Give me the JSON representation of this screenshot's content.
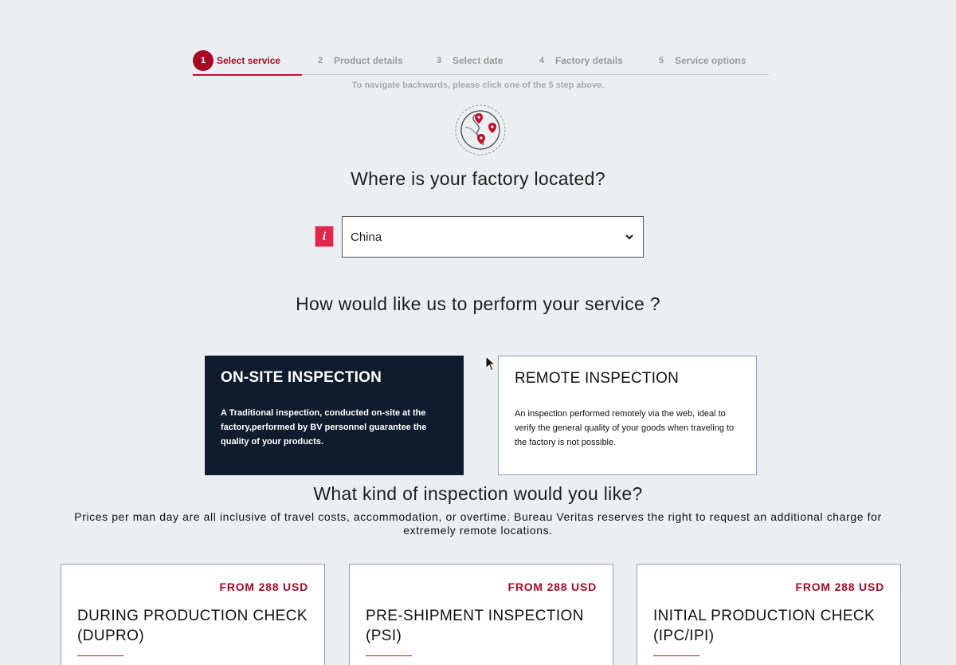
{
  "stepper": {
    "steps": [
      {
        "num": "1",
        "label": "Select service"
      },
      {
        "num": "2",
        "label": "Product details"
      },
      {
        "num": "3",
        "label": "Select date"
      },
      {
        "num": "4",
        "label": "Factory details"
      },
      {
        "num": "5",
        "label": "Service options"
      }
    ],
    "active_step": 1,
    "hint": "To navigate backwards, please click one of the 5 step above."
  },
  "location": {
    "icon": "map-route-icon",
    "question": "Where is your factory located?",
    "info_label": "i",
    "selected_country": "China"
  },
  "service_mode": {
    "question": "How would like us to perform your service ?",
    "options": [
      {
        "title": "ON-SITE INSPECTION",
        "description": "A Traditional inspection, conducted on-site at the factory,performed by BV personnel guarantee the quality of your products.",
        "selected": true
      },
      {
        "title": "REMOTE INSPECTION",
        "description": "An inspection performed remotely via the web, ideal to verify the general quality of your goods when traveling to the factory is not possible.",
        "selected": false
      }
    ]
  },
  "inspection_kind": {
    "question": "What kind of inspection would you like?",
    "note": "Prices per man day are all inclusive of travel costs, accommodation, or overtime. Bureau Veritas reserves the right to request an additional charge for extremely remote locations.",
    "products": [
      {
        "price": "FROM 288 USD",
        "name": "DURING PRODUCTION CHECK (DUPRO)"
      },
      {
        "price": "FROM 288 USD",
        "name": "PRE-SHIPMENT INSPECTION (PSI)"
      },
      {
        "price": "FROM 288 USD",
        "name": "INITIAL PRODUCTION CHECK (IPC/IPI)"
      }
    ]
  },
  "colors": {
    "accent": "#a50b25",
    "dark_card": "#0f1c2e",
    "background": "#eceff1",
    "info_badge": "#e0264a"
  }
}
